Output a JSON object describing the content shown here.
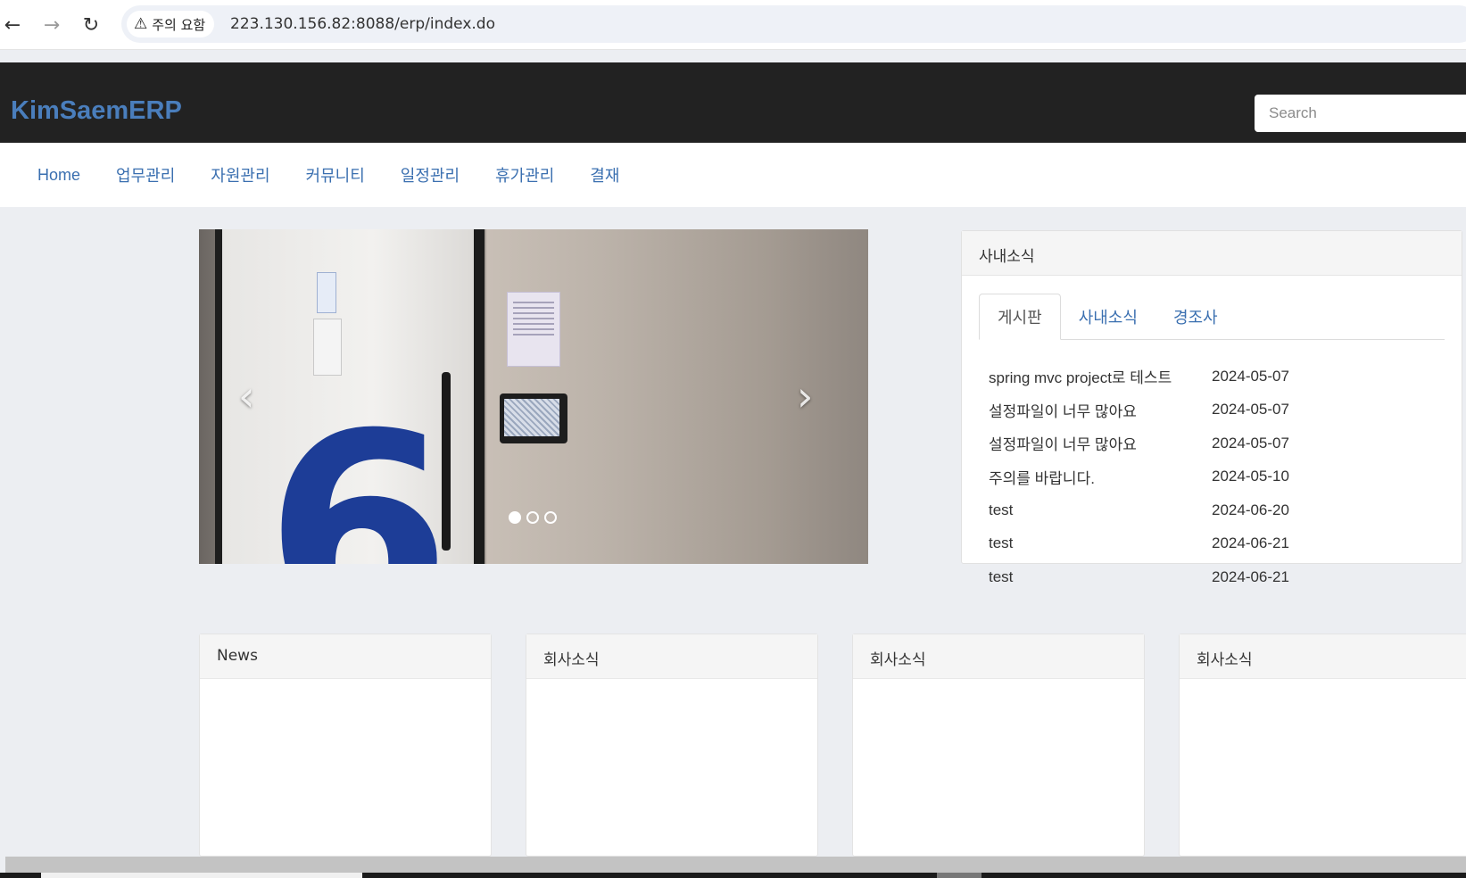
{
  "browser": {
    "back_icon": "←",
    "forward_icon": "→",
    "reload_icon": "↻",
    "security_label": "주의 요함",
    "url": "223.130.156.82:8088/erp/index.do"
  },
  "header": {
    "brand": "KimSaemERP",
    "search_placeholder": "Search"
  },
  "menu": {
    "items": [
      "Home",
      "업무관리",
      "자원관리",
      "커뮤니티",
      "일정관리",
      "휴가관리",
      "결재"
    ]
  },
  "carousel": {
    "prev_icon": "‹",
    "next_icon": "›",
    "slide_count": 3,
    "active_slide": 1
  },
  "news_panel": {
    "title": "사내소식",
    "tabs": [
      "게시판",
      "사내소식",
      "경조사"
    ],
    "active_tab": "게시판",
    "posts": [
      {
        "title": "spring mvc project로 테스트",
        "date": "2024-05-07"
      },
      {
        "title": "설정파일이 너무 많아요",
        "date": "2024-05-07"
      },
      {
        "title": "설정파일이 너무 많아요",
        "date": "2024-05-07"
      },
      {
        "title": "주의를 바랍니다.",
        "date": "2024-05-10"
      },
      {
        "title": "test",
        "date": "2024-06-20"
      },
      {
        "title": "test",
        "date": "2024-06-21"
      },
      {
        "title": "test",
        "date": "2024-06-21"
      }
    ]
  },
  "cards": [
    "News",
    "회사소식",
    "회사소식",
    "회사소식"
  ],
  "colors": {
    "brand": "#4a7ebc",
    "link": "#3a6fb0",
    "header_bg": "#222222",
    "page_bg": "#eceef2"
  }
}
